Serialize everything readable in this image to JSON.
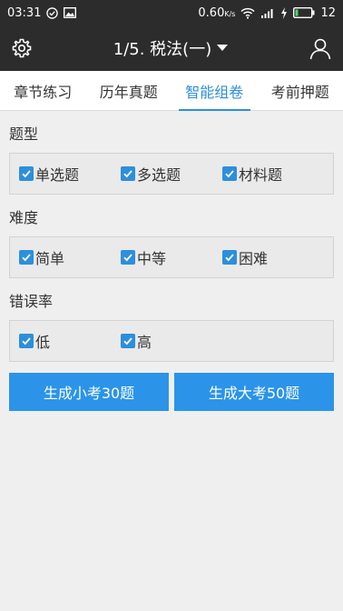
{
  "status_bar": {
    "time": "03:31",
    "net_speed": "0.60",
    "net_unit": "K/s",
    "battery": "12"
  },
  "app_bar": {
    "title": "1/5. 税法(一)"
  },
  "tabs": [
    {
      "label": "章节练习",
      "active": false
    },
    {
      "label": "历年真题",
      "active": false
    },
    {
      "label": "智能组卷",
      "active": true
    },
    {
      "label": "考前押题",
      "active": false
    }
  ],
  "sections": {
    "type": {
      "title": "题型",
      "options": [
        {
          "label": "单选题",
          "checked": true
        },
        {
          "label": "多选题",
          "checked": true
        },
        {
          "label": "材料题",
          "checked": true
        }
      ]
    },
    "difficulty": {
      "title": "难度",
      "options": [
        {
          "label": "简单",
          "checked": true
        },
        {
          "label": "中等",
          "checked": true
        },
        {
          "label": "困难",
          "checked": true
        }
      ]
    },
    "error_rate": {
      "title": "错误率",
      "options": [
        {
          "label": "低",
          "checked": true
        },
        {
          "label": "高",
          "checked": true
        }
      ]
    }
  },
  "buttons": {
    "small_exam": "生成小考30题",
    "big_exam": "生成大考50题"
  },
  "colors": {
    "accent": "#2c8fdc",
    "button": "#2b94e8",
    "bar": "#2c2c2c"
  }
}
